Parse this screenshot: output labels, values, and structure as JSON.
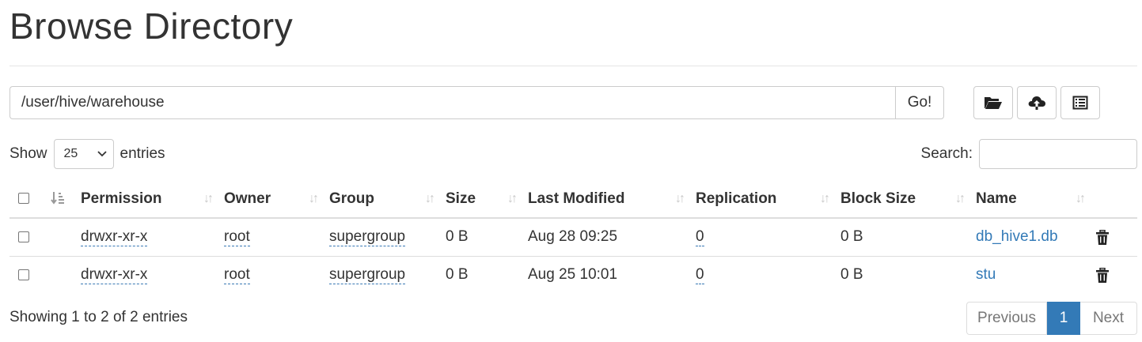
{
  "page": {
    "title": "Browse Directory"
  },
  "path_bar": {
    "value": "/user/hive/warehouse",
    "go_label": "Go!"
  },
  "toolbar": {
    "icons": [
      "folder-open-icon",
      "cloud-upload-icon",
      "list-icon"
    ]
  },
  "length": {
    "show_label": "Show",
    "selected": "25",
    "entries_label": "entries"
  },
  "search": {
    "label": "Search:",
    "value": ""
  },
  "table": {
    "headers": [
      "Permission",
      "Owner",
      "Group",
      "Size",
      "Last Modified",
      "Replication",
      "Block Size",
      "Name"
    ],
    "rows": [
      {
        "permission": "drwxr-xr-x",
        "owner": "root",
        "group": "supergroup",
        "size": "0 B",
        "modified": "Aug 28 09:25",
        "replication": "0",
        "block_size": "0 B",
        "name": "db_hive1.db"
      },
      {
        "permission": "drwxr-xr-x",
        "owner": "root",
        "group": "supergroup",
        "size": "0 B",
        "modified": "Aug 25 10:01",
        "replication": "0",
        "block_size": "0 B",
        "name": "stu"
      }
    ]
  },
  "footer": {
    "info": "Showing 1 to 2 of 2 entries",
    "previous": "Previous",
    "current_page": "1",
    "next": "Next"
  },
  "colors": {
    "accent": "#337ab7",
    "border": "#dddddd",
    "text": "#333333"
  }
}
